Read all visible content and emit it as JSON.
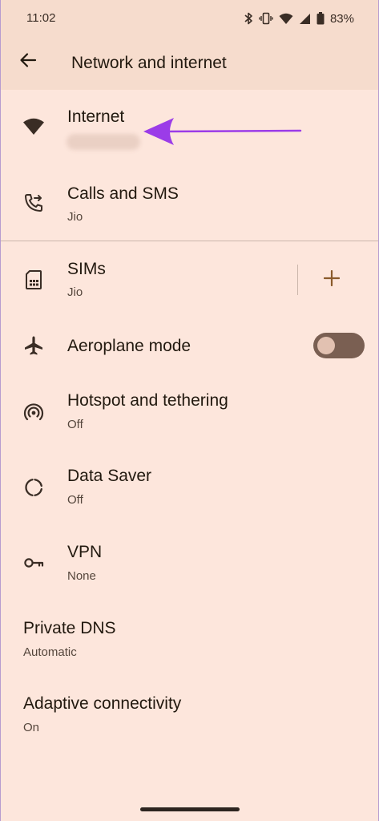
{
  "status_bar": {
    "time": "11:02",
    "battery_percent": "83%",
    "icons": [
      "bluetooth-icon",
      "vibrate-icon",
      "wifi-icon",
      "signal-icon",
      "battery-icon"
    ]
  },
  "app_bar": {
    "title": "Network and internet",
    "back_icon": "arrow-back-icon"
  },
  "items": {
    "internet": {
      "title": "Internet",
      "subtitle_blurred": true,
      "icon": "wifi-icon"
    },
    "calls_sms": {
      "title": "Calls and SMS",
      "subtitle": "Jio",
      "icon": "phone-forward-icon"
    },
    "sims": {
      "title": "SIMs",
      "subtitle": "Jio",
      "icon": "sim-card-icon",
      "action_icon": "add-icon"
    },
    "aeroplane": {
      "title": "Aeroplane mode",
      "icon": "airplane-icon",
      "toggle_on": false
    },
    "hotspot": {
      "title": "Hotspot and tethering",
      "subtitle": "Off",
      "icon": "hotspot-icon"
    },
    "data_saver": {
      "title": "Data Saver",
      "subtitle": "Off",
      "icon": "data-saver-icon"
    },
    "vpn": {
      "title": "VPN",
      "subtitle": "None",
      "icon": "vpn-key-icon"
    },
    "private_dns": {
      "title": "Private DNS",
      "subtitle": "Automatic"
    },
    "adaptive": {
      "title": "Adaptive connectivity",
      "subtitle": "On"
    }
  },
  "annotation": {
    "arrow_color": "#9b3ce8"
  },
  "colors": {
    "background": "#fde6dc",
    "header": "#f6dccd",
    "icon": "#3a2d25",
    "accent": "#8a5a2b",
    "toggle_track": "#7a5f52"
  }
}
